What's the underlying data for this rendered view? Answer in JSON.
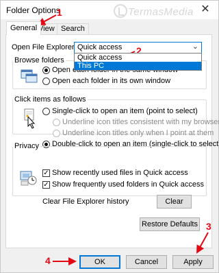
{
  "window": {
    "title": "Folder Options",
    "close_glyph": "✕",
    "watermark": "TermasMedia"
  },
  "tabs": [
    {
      "label": "General",
      "active": true
    },
    {
      "label": "View",
      "active": false
    },
    {
      "label": "Search",
      "active": false
    }
  ],
  "general": {
    "open_label": "Open File Explorer to:",
    "combo_value": "Quick access",
    "combo_arrow": "⌄",
    "dropdown_options": [
      "Quick access",
      "This PC"
    ],
    "dropdown_highlighted": "This PC",
    "browse": {
      "title": "Browse folders",
      "option1": "Open each folder in the same window",
      "option2": "Open each folder in its own window",
      "selected": "option1"
    },
    "click": {
      "title": "Click items as follows",
      "option1": "Single-click to open an item (point to select)",
      "sub1": "Underline icon titles consistent with my browser",
      "sub2": "Underline icon titles only when I point at them",
      "option2": "Double-click to open an item (single-click to select)",
      "selected": "option2"
    },
    "privacy": {
      "title": "Privacy",
      "check1": "Show recently used files in Quick access",
      "check2": "Show frequently used folders in Quick access",
      "clear_label": "Clear File Explorer history",
      "clear_button": "Clear",
      "check_glyph": "✓"
    },
    "restore_button": "Restore Defaults"
  },
  "footer": {
    "ok": "OK",
    "cancel": "Cancel",
    "apply": "Apply"
  },
  "annotations": {
    "n1": "1",
    "n2": "2",
    "n3": "3",
    "n4": "4",
    "color": "#e30613"
  }
}
